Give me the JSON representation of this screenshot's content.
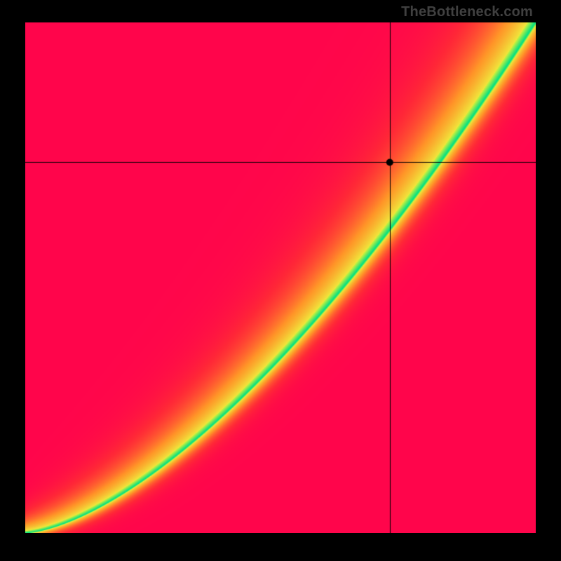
{
  "watermark": "TheBottleneck.com",
  "chart_data": {
    "type": "heatmap",
    "title": "",
    "xlabel": "",
    "ylabel": "",
    "xlim": [
      0,
      100
    ],
    "ylim": [
      0,
      100
    ],
    "colormap": "green-yellow-red gradient by deviation from optimal ridge",
    "ridge_description": "green optimal band follows a superlinear diagonal; below the ridge skews red (gpu-limited), above skews yellow-red (cpu-limited)",
    "crosshair": {
      "x": 71.4,
      "y": 72.6
    },
    "marker": {
      "x": 71.4,
      "y": 72.6
    },
    "corner_colors": {
      "top_left": "red",
      "top_right": "yellow",
      "bottom_left": "red",
      "bottom_right": "red"
    },
    "render": {
      "resolution": 728,
      "ridge_exponent": 1.55,
      "ridge_width_base": 0.012,
      "ridge_width_scale": 0.055,
      "below_bias": 2.1,
      "above_scale": 0.65,
      "yellow_threshold": 0.15,
      "red_threshold": 0.85
    }
  }
}
